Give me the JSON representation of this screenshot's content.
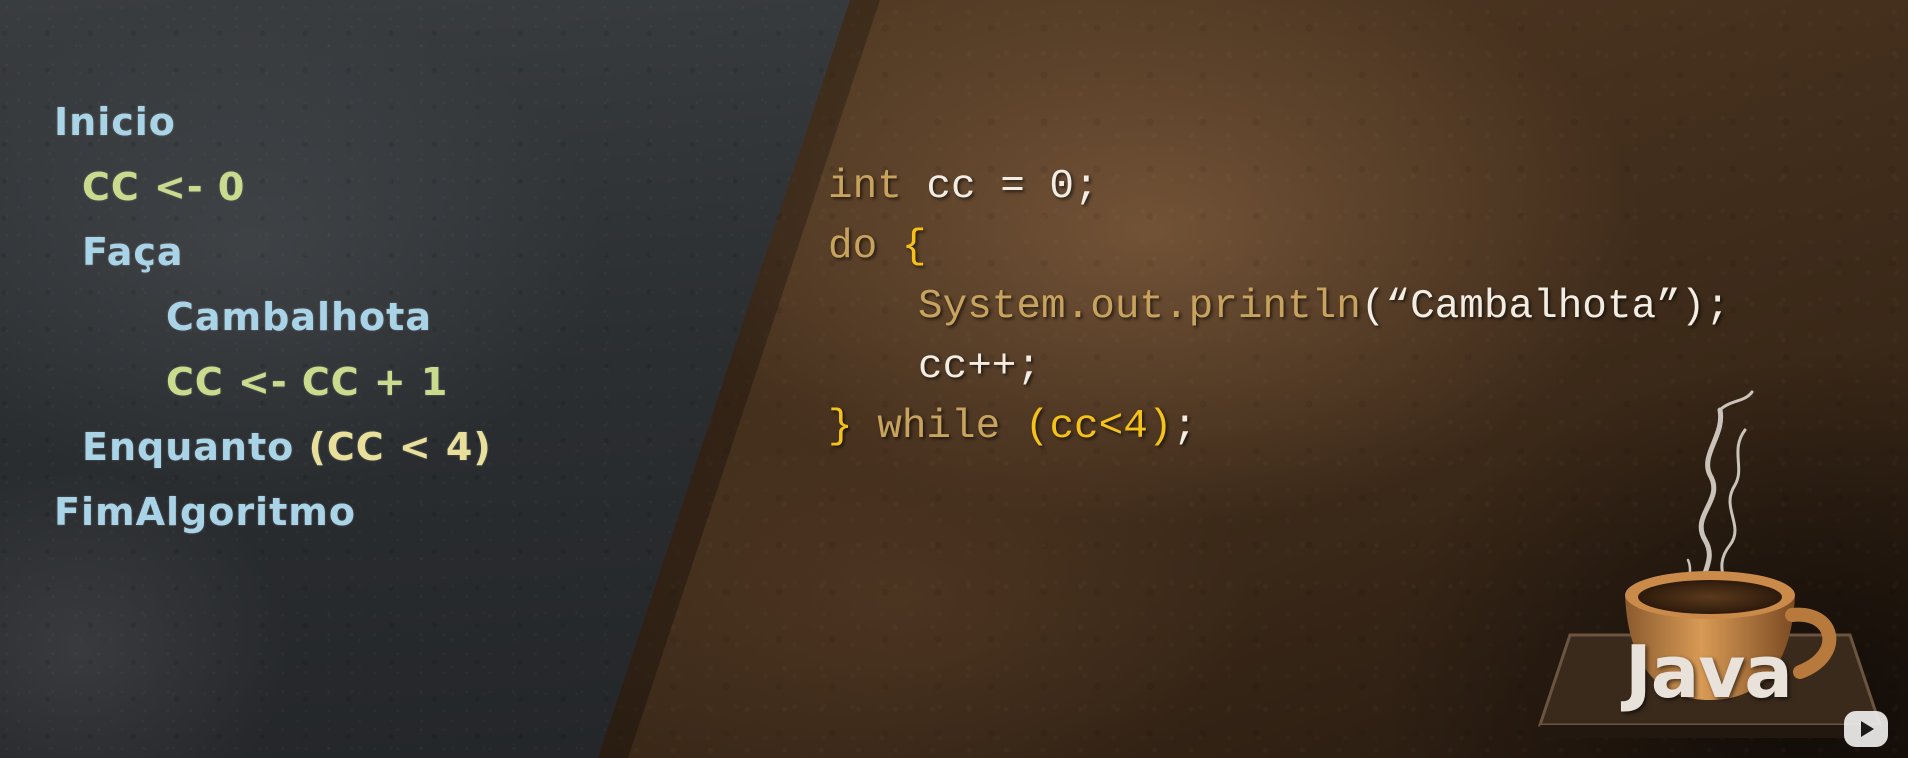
{
  "pseudocode": {
    "lines": [
      "Inicio",
      "CC <- 0",
      "Faça",
      "Cambalhota",
      "CC <- CC + 1",
      "Enquanto ",
      "(CC < 4)",
      "FimAlgoritmo"
    ]
  },
  "java": {
    "line1": {
      "kw": "int",
      "rest": " cc = 0;"
    },
    "line2": {
      "kw": "do",
      "brace": " {"
    },
    "line3": {
      "method": "System.out.println",
      "rest": "(“Cambalhota”);"
    },
    "line4": {
      "rest": "cc++;"
    },
    "line5": {
      "brace": "}",
      "kw": " while ",
      "cond": "(cc<4)",
      "rest": ";"
    }
  },
  "logo": {
    "text": "Java"
  },
  "icons": {
    "coffee_cup": "coffee-cup-icon",
    "steam": "steam-icon",
    "play": "youtube-play-icon"
  },
  "colors": {
    "chalk_blue": "#a9d4e8",
    "chalk_green": "#c9dc8d",
    "chalk_yellow": "#e7df9a",
    "keyword": "#c7a35e",
    "brace": "#f5c318",
    "identifier": "#f2ece2"
  }
}
